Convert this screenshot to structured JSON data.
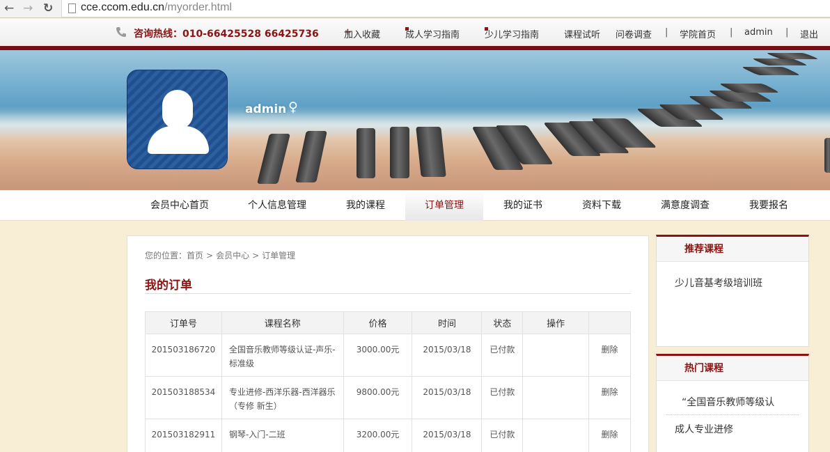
{
  "browser": {
    "back_glyph": "←",
    "forward_glyph": "→",
    "reload_glyph": "↻",
    "url_host": "cce.ccom.edu.cn",
    "url_path": "/myorder.html"
  },
  "topbar": {
    "hotline": "咨询热线：010-66425528 66425736",
    "links": [
      {
        "label": "加入收藏",
        "marker": "plus"
      },
      {
        "label": "成人学习指南",
        "marker": "square"
      },
      {
        "label": "少儿学习指南",
        "marker": "square"
      },
      {
        "label": "课程试听",
        "marker": "none"
      },
      {
        "label": "问卷调查",
        "marker": "none"
      },
      {
        "label": "学院首页",
        "marker": "none"
      },
      {
        "label": "admin",
        "marker": "none"
      },
      {
        "label": "退出",
        "marker": "none"
      }
    ],
    "separator": "|"
  },
  "profile": {
    "username": "admin",
    "gender_symbol": "♀"
  },
  "nav": {
    "items": [
      "会员中心首页",
      "个人信息管理",
      "我的课程",
      "订单管理",
      "我的证书",
      "资料下载",
      "满意度调查",
      "我要报名"
    ],
    "active": "订单管理"
  },
  "breadcrumb": {
    "prefix": "您的位置：",
    "items": [
      "首页",
      "会员中心",
      "订单管理"
    ],
    "separator": ">"
  },
  "orders": {
    "title": "我的订单",
    "columns": [
      "订单号",
      "课程名称",
      "价格",
      "时间",
      "状态",
      "操作",
      ""
    ],
    "rows": [
      {
        "id": "201503186720",
        "course": "全国音乐教师等级认证-声乐-标准级",
        "price": "3000.00元",
        "date": "2015/03/18",
        "status": "已付款",
        "op": "",
        "action": "删除"
      },
      {
        "id": "201503188534",
        "course": "专业进修-西洋乐器-西洋器乐（专修 新生）",
        "price": "9800.00元",
        "date": "2015/03/18",
        "status": "已付款",
        "op": "",
        "action": "删除"
      },
      {
        "id": "201503182911",
        "course": "钢琴-入门-二班",
        "price": "3200.00元",
        "date": "2015/03/18",
        "status": "已付款",
        "op": "",
        "action": "删除"
      }
    ]
  },
  "sidebar": {
    "recommended": {
      "title": "推荐课程",
      "items": [
        "少儿音基考级培训班"
      ]
    },
    "hot": {
      "title": "热门课程",
      "items": [
        "“全国音乐教师等级认",
        "成人专业进修"
      ]
    }
  },
  "colors": {
    "brand": "#8a1414",
    "page_bg": "#f8eed6"
  }
}
